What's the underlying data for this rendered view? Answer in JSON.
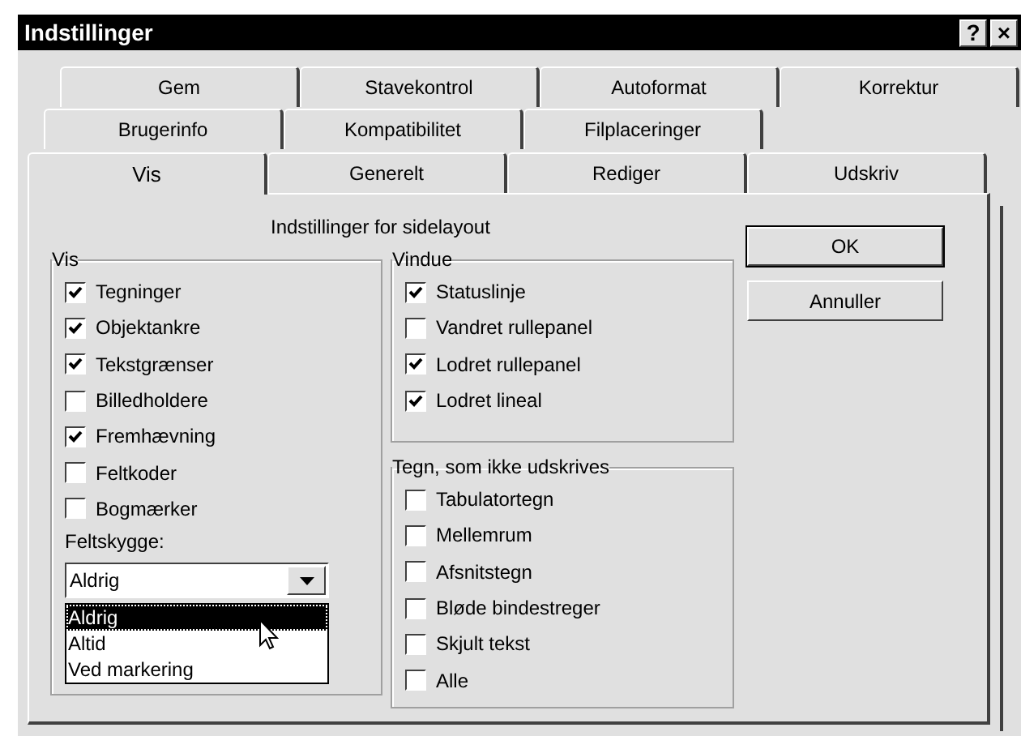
{
  "window": {
    "title": "Indstillinger",
    "help_button": "?",
    "close_button": "×"
  },
  "tab_rows": [
    [
      {
        "label": "Gem",
        "selected": false
      },
      {
        "label": "Stavekontrol",
        "selected": false
      },
      {
        "label": "Autoformat",
        "selected": false
      },
      {
        "label": "Korrektur",
        "selected": false
      }
    ],
    [
      {
        "label": "Brugerinfo",
        "selected": false
      },
      {
        "label": "Kompatibilitet",
        "selected": false
      },
      {
        "label": "Filplaceringer",
        "selected": false
      }
    ],
    [
      {
        "label": "Vis",
        "selected": true
      },
      {
        "label": "Generelt",
        "selected": false
      },
      {
        "label": "Rediger",
        "selected": false
      },
      {
        "label": "Udskriv",
        "selected": false
      }
    ]
  ],
  "panel": {
    "heading": "Indstillinger for sidelayout",
    "vis_group": {
      "title": "Vis",
      "options": [
        {
          "label": "Tegninger",
          "checked": true
        },
        {
          "label": "Objektankre",
          "checked": true
        },
        {
          "label": "Tekstgrænser",
          "checked": true
        },
        {
          "label": "Billedholdere",
          "checked": false
        },
        {
          "label": "Fremhævning",
          "checked": true
        },
        {
          "label": "Feltkoder",
          "checked": false
        },
        {
          "label": "Bogmærker",
          "checked": false
        }
      ],
      "field_shading": {
        "label": "Feltskygge:",
        "value": "Aldrig",
        "expanded": true,
        "options": [
          {
            "label": "Aldrig",
            "selected": true
          },
          {
            "label": "Altid",
            "selected": false
          },
          {
            "label": "Ved markering",
            "selected": false
          }
        ]
      }
    },
    "window_group": {
      "title": "Vindue",
      "options": [
        {
          "label": "Statuslinje",
          "checked": true
        },
        {
          "label": "Vandret rullepanel",
          "checked": false
        },
        {
          "label": "Lodret rullepanel",
          "checked": true
        },
        {
          "label": "Lodret lineal",
          "checked": true
        }
      ]
    },
    "nonprinting_group": {
      "title": "Tegn, som ikke udskrives",
      "options": [
        {
          "label": "Tabulatortegn",
          "checked": false
        },
        {
          "label": "Mellemrum",
          "checked": false
        },
        {
          "label": "Afsnitstegn",
          "checked": false
        },
        {
          "label": "Bløde bindestreger",
          "checked": false
        },
        {
          "label": "Skjult tekst",
          "checked": false
        },
        {
          "label": "Alle",
          "checked": false
        }
      ]
    },
    "buttons": [
      {
        "label": "OK",
        "default": true
      },
      {
        "label": "Annuller",
        "default": false
      }
    ]
  }
}
